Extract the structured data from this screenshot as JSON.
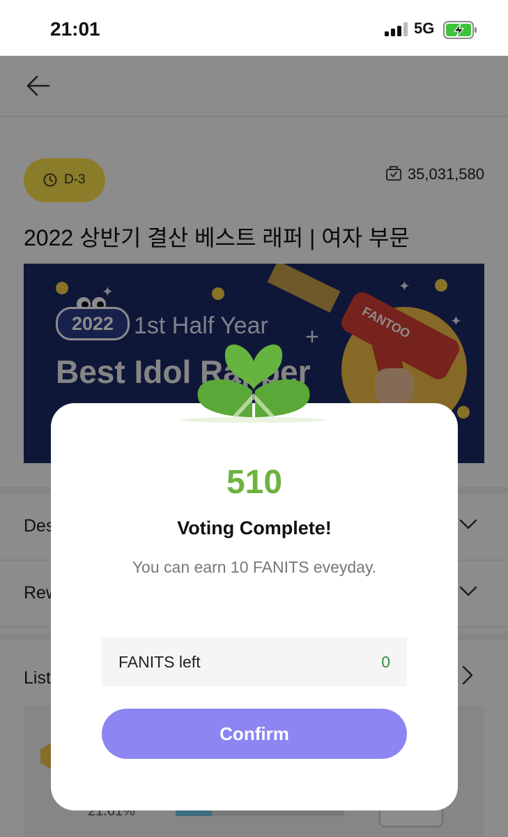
{
  "status_bar": {
    "time": "21:01",
    "network": "5G"
  },
  "header": {
    "back_icon": "arrow-left-icon"
  },
  "event": {
    "d_day": "D-3",
    "vote_count": "35,031,580",
    "title": "2022 상반기 결산 베스트 래퍼 | 여자 부문"
  },
  "banner": {
    "year": "2022",
    "subtitle": "1st Half Year",
    "headline": "Best Idol Rapper",
    "brand": "FANTOO"
  },
  "sections": [
    {
      "label": "Description"
    },
    {
      "label": "Reward"
    },
    {
      "label": "List"
    }
  ],
  "list_preview": {
    "percent": "21.61%",
    "progress": 0.2161
  },
  "modal": {
    "points": "510",
    "title": "Voting Complete!",
    "subtitle": "You can earn 10 FANITS eveyday.",
    "fanits_label": "FANITS left",
    "fanits_value": "0",
    "confirm_label": "Confirm"
  },
  "colors": {
    "badge_yellow": "#fbe24a",
    "points_green": "#6db33f",
    "confirm_purple": "#8c85f2",
    "banner_navy": "#1c2a66"
  }
}
